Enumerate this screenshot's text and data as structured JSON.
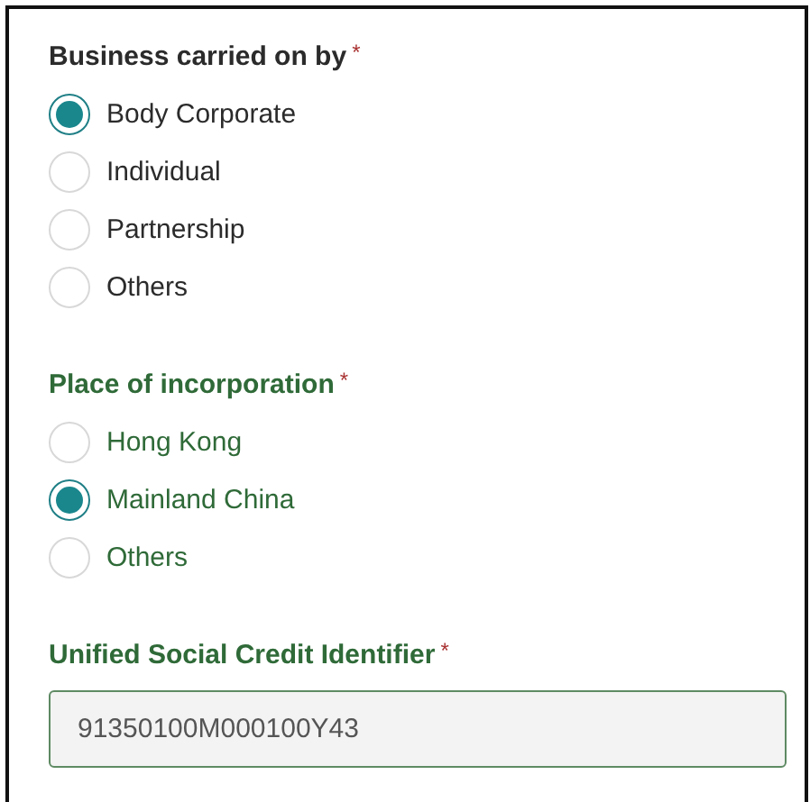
{
  "sections": [
    {
      "kind": "radio",
      "label": "Business carried on by",
      "required_mark": "*",
      "color": "#2b2b2b",
      "options": [
        {
          "label": "Body Corporate",
          "selected": true
        },
        {
          "label": "Individual",
          "selected": false
        },
        {
          "label": "Partnership",
          "selected": false
        },
        {
          "label": "Others",
          "selected": false
        }
      ]
    },
    {
      "kind": "radio",
      "label": "Place of incorporation",
      "required_mark": "*",
      "color": "#2f6a38",
      "options": [
        {
          "label": "Hong Kong",
          "selected": false
        },
        {
          "label": "Mainland China",
          "selected": true
        },
        {
          "label": "Others",
          "selected": false
        }
      ]
    },
    {
      "kind": "text",
      "label": "Unified Social Credit Identifier",
      "required_mark": "*",
      "color": "#2f6a38",
      "value": "91350100M000100Y43"
    }
  ]
}
